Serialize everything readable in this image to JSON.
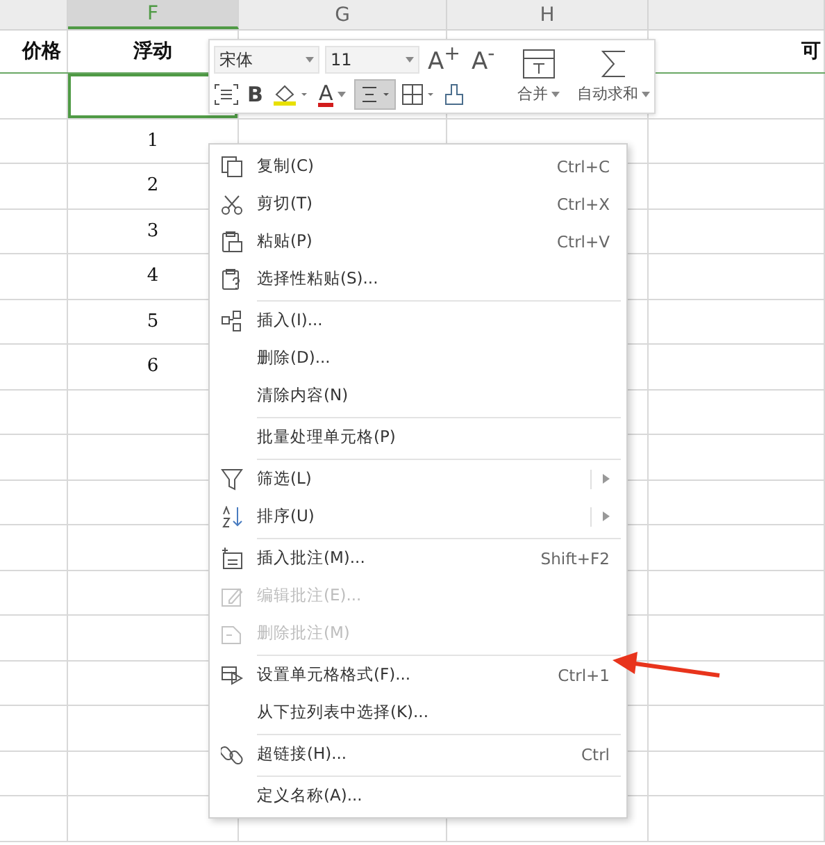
{
  "sheet": {
    "columns": [
      {
        "heading": "价格"
      },
      {
        "header": "F",
        "selected": true,
        "heading": "浮动"
      },
      {
        "header": "G",
        "selected": false
      },
      {
        "header": "H",
        "selected": false
      },
      {
        "heading": "可"
      }
    ],
    "f_rows": [
      {
        "selected": true
      },
      {
        "value": "1",
        "selected": false
      },
      {
        "value": "2",
        "selected": false
      },
      {
        "value": "3",
        "selected": false
      },
      {
        "value": "4",
        "selected": false
      },
      {
        "value": "5",
        "selected": false
      },
      {
        "value": "6",
        "selected": false
      }
    ]
  },
  "toolbar": {
    "font": "宋体",
    "size": "11",
    "grow_font": "A$^{+}$",
    "shrink_font": "A$^{-}$",
    "merge": "合并",
    "autosum": "自动求和",
    "bold": "B",
    "font_color": "A",
    "align_center": {
      "selected": true
    }
  },
  "context_menu": [
    {
      "label": "复制(C)",
      "shortcut": "Ctrl+C",
      "disabled": false,
      "submenu": false,
      "separator_after": false
    },
    {
      "label": "剪切(T)",
      "shortcut": "Ctrl+X",
      "disabled": false,
      "submenu": false,
      "separator_after": false
    },
    {
      "label": "粘贴(P)",
      "shortcut": "Ctrl+V",
      "disabled": false,
      "submenu": false,
      "separator_after": false
    },
    {
      "label": "选择性粘贴(S)...",
      "disabled": false,
      "submenu": false,
      "separator_after": true
    },
    {
      "label": "插入(I)...",
      "disabled": false,
      "submenu": false,
      "separator_after": false
    },
    {
      "label": "删除(D)...",
      "disabled": false,
      "submenu": false,
      "separator_after": false
    },
    {
      "label": "清除内容(N)",
      "disabled": false,
      "submenu": false,
      "separator_after": true
    },
    {
      "label": "批量处理单元格(P)",
      "disabled": false,
      "submenu": false,
      "separator_after": true
    },
    {
      "label": "筛选(L)",
      "disabled": false,
      "submenu": true,
      "separator_after": false
    },
    {
      "label": "排序(U)",
      "disabled": false,
      "submenu": true,
      "separator_after": true
    },
    {
      "label": "插入批注(M)...",
      "shortcut": "Shift+F2",
      "disabled": false,
      "submenu": false,
      "separator_after": false
    },
    {
      "label": "编辑批注(E)...",
      "disabled": true,
      "submenu": false,
      "separator_after": false
    },
    {
      "label": "删除批注(M)",
      "disabled": true,
      "submenu": false,
      "separator_after": true
    },
    {
      "label": "设置单元格格式(F)...",
      "shortcut": "Ctrl+1",
      "disabled": false,
      "submenu": false,
      "separator_after": false
    },
    {
      "label": "从下拉列表中选择(K)...",
      "disabled": false,
      "submenu": false,
      "separator_after": true
    },
    {
      "label": "超链接(H)...",
      "shortcut": "Ctrl",
      "disabled": false,
      "submenu": false,
      "separator_after": true
    },
    {
      "label": "定义名称(A)...",
      "disabled": false,
      "submenu": false,
      "separator_after": false
    }
  ]
}
